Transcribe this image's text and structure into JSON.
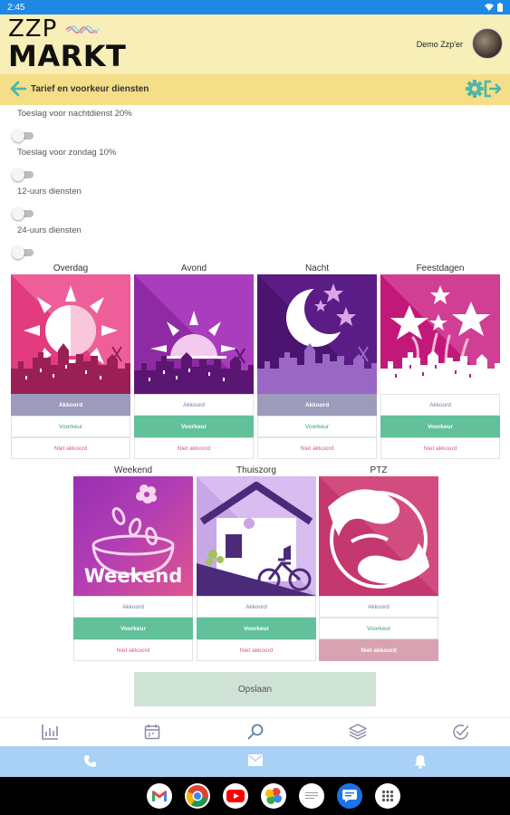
{
  "status_bar": {
    "time": "2:45"
  },
  "header": {
    "logo_line1": "ZZP",
    "logo_line2": "MARKT",
    "user_name": "Demo Zzp'er"
  },
  "subheader": {
    "title": "Tarief en voorkeur diensten"
  },
  "toggles": [
    {
      "label": "Toeslag voor nachtdienst 20%"
    },
    {
      "label": "Toeslag voor zondag 10%"
    },
    {
      "label": "12-uurs diensten"
    },
    {
      "label": "24-uurs diensten"
    }
  ],
  "option_labels": {
    "akkoord": "Akkoord",
    "voorkeur": "Voorkeur",
    "niet_akkoord": "Niet akkoord"
  },
  "shift_types": [
    {
      "name": "Overdag",
      "selected": "akkoord"
    },
    {
      "name": "Avond",
      "selected": "voorkeur"
    },
    {
      "name": "Nacht",
      "selected": "akkoord"
    },
    {
      "name": "Feestdagen",
      "selected": "voorkeur"
    },
    {
      "name": "Weekend",
      "selected": "voorkeur",
      "image_text": "Weekend"
    },
    {
      "name": "Thuiszorg",
      "selected": "voorkeur"
    },
    {
      "name": "PTZ",
      "selected": "niet_akkoord"
    }
  ],
  "save_button": {
    "label": "Opslaan"
  },
  "bottom_nav": [
    "chart-icon",
    "calendar-icon",
    "search-icon",
    "layers-icon",
    "check-circle-icon"
  ],
  "contact_bar": [
    "phone-icon",
    "mail-icon",
    "bell-icon"
  ],
  "colors": {
    "header_bg": "#f7efb7",
    "subheader_bg": "#f4df88",
    "accent_green": "#62c09a",
    "akkoord_selected": "#9d9bbc",
    "niet_akkoord_selected": "#d8a2b0",
    "contact_bar_bg": "#a9d0f5",
    "status_bar_bg": "#1e88e5"
  }
}
